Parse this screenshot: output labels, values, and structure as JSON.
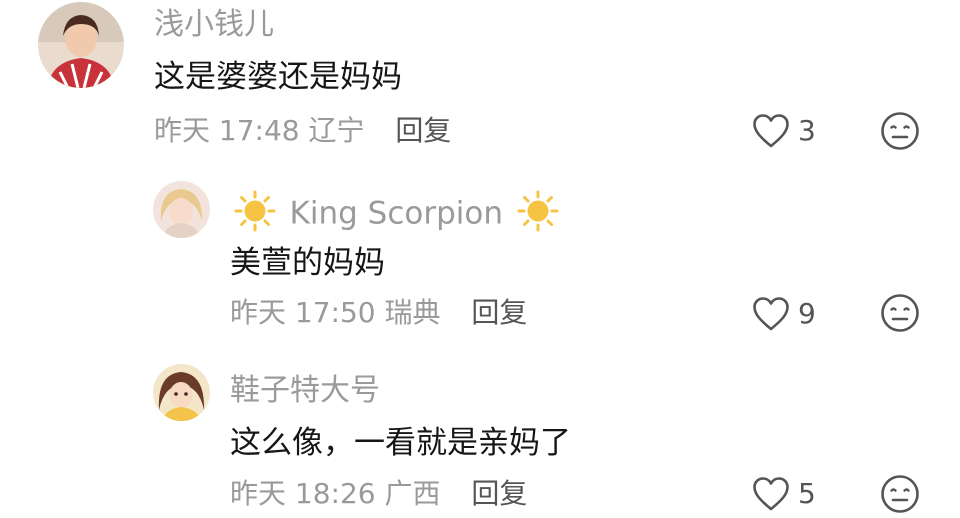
{
  "comments": [
    {
      "username": "浅小钱儿",
      "text": "这是婆婆还是妈妈",
      "time": "昨天 17:48",
      "location": "辽宁",
      "reply_label": "回复",
      "likes": "3",
      "avatar_icon": "user-avatar-photo"
    },
    {
      "username": "King Scorpion",
      "text": "美萱的妈妈",
      "time": "昨天 17:50",
      "location": "瑞典",
      "reply_label": "回复",
      "likes": "9",
      "avatar_icon": "user-avatar-photo"
    },
    {
      "username": "鞋子特大号",
      "text": "这么像，一看就是亲妈了",
      "time": "昨天 18:26",
      "location": "广西",
      "reply_label": "回复",
      "likes": "5",
      "avatar_icon": "user-avatar-illustration"
    }
  ],
  "icons": {
    "like": "heart-outline-icon",
    "dislike": "neutral-face-icon",
    "name_decoration": "sun-emoji-icon"
  },
  "colors": {
    "username": "#9a9a9a",
    "text": "#161616",
    "meta": "#9a9a9a",
    "reply": "#555555",
    "sun": "#f6c343"
  }
}
